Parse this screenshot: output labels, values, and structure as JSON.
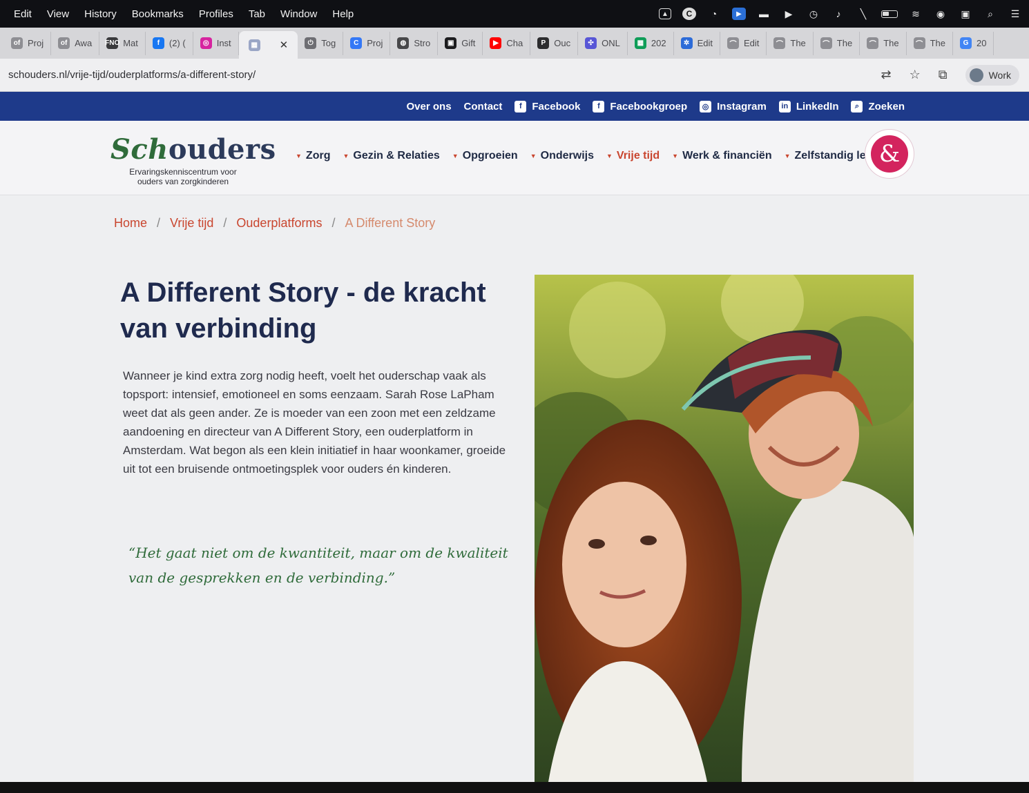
{
  "menubar": {
    "items": [
      "Edit",
      "View",
      "History",
      "Bookmarks",
      "Profiles",
      "Tab",
      "Window",
      "Help"
    ]
  },
  "tabs": [
    {
      "label": "Proj",
      "icon": "of-icon"
    },
    {
      "label": "Awa",
      "icon": "of-icon"
    },
    {
      "label": "Mat",
      "icon": "fno-icon"
    },
    {
      "label": "(2) (",
      "icon": "facebook-icon"
    },
    {
      "label": "Inst",
      "icon": "instagram-icon"
    },
    {
      "label": "",
      "icon": "site-icon",
      "active": true
    },
    {
      "label": "Tog",
      "icon": "toggl-icon"
    },
    {
      "label": "Proj",
      "icon": "c-icon"
    },
    {
      "label": "Stro",
      "icon": "globe-icon"
    },
    {
      "label": "Gift",
      "icon": "gift-icon"
    },
    {
      "label": "Cha",
      "icon": "youtube-icon"
    },
    {
      "label": "Ouc",
      "icon": "p-icon"
    },
    {
      "label": "ONL",
      "icon": "dots-icon"
    },
    {
      "label": "202",
      "icon": "sheets-icon"
    },
    {
      "label": "Edit",
      "icon": "gear-icon"
    },
    {
      "label": "Edit",
      "icon": "hat-icon"
    },
    {
      "label": "The",
      "icon": "hat-icon"
    },
    {
      "label": "The",
      "icon": "hat-icon"
    },
    {
      "label": "The",
      "icon": "hat-icon"
    },
    {
      "label": "The",
      "icon": "hat-icon"
    },
    {
      "label": "20",
      "icon": "google-icon"
    }
  ],
  "address": {
    "url": "schouders.nl/vrije-tijd/ouderplatforms/a-different-story/",
    "profile": "Work"
  },
  "topbar": {
    "links": [
      "Over ons",
      "Contact"
    ],
    "social": [
      {
        "label": "Facebook",
        "icon": "f"
      },
      {
        "label": "Facebookgroep",
        "icon": "f"
      },
      {
        "label": "Instagram",
        "icon": "◎"
      },
      {
        "label": "LinkedIn",
        "icon": "in"
      },
      {
        "label": "Zoeken",
        "icon": "⌕"
      }
    ]
  },
  "logo": {
    "prefix": "Sch",
    "suffix": "ouders",
    "tagline_1": "Ervaringskenniscentrum voor",
    "tagline_2": "ouders van zorgkinderen"
  },
  "nav": [
    {
      "label": "Zorg"
    },
    {
      "label": "Gezin & Relaties"
    },
    {
      "label": "Opgroeien"
    },
    {
      "label": "Onderwijs"
    },
    {
      "label": "Vrije tijd",
      "active": true
    },
    {
      "label": "Werk & financiën"
    },
    {
      "label": "Zelfstandig leven"
    }
  ],
  "badge": {
    "symbol": "&",
    "colors": {
      "ring": "#d3245e"
    }
  },
  "breadcrumb": {
    "home": "Home",
    "level1": "Vrije tijd",
    "level2": "Ouderplatforms",
    "current": "A Different Story"
  },
  "article": {
    "title": "A Different Story - de kracht van verbinding",
    "intro": "Wanneer je kind extra zorg nodig heeft, voelt het ouderschap vaak als topsport: intensief, emotioneel en soms eenzaam. Sarah Rose LaPham weet dat als geen ander. Ze is moeder van een zoon met een zeldzame aandoening en directeur van A Different Story, een ouderplatform in Amsterdam. Wat begon als een klein initiatief in haar woonkamer, groeide uit tot een bruisende ontmoetingsplek voor ouders én kinderen.",
    "quote": "“Het gaat niet om de kwantiteit, maar om de kwaliteit van de gesprekken en de verbinding.”"
  },
  "colors": {
    "brand_blue": "#1e3a8a",
    "accent": "#c9462f",
    "quote_green": "#2f6b3a",
    "title_navy": "#1f2a4e"
  }
}
